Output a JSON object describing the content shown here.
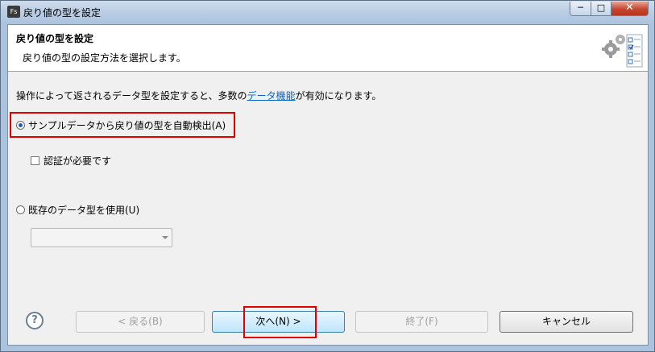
{
  "window": {
    "title": "戻り値の型を設定",
    "app_icon_text": "Fs",
    "controls": {
      "minimize": "─",
      "maximize": "□",
      "close": "✕"
    }
  },
  "banner": {
    "title": "戻り値の型を設定",
    "description": "戻り値の型の設定方法を選択します。",
    "icon": "gears-checklist-icon"
  },
  "info": {
    "prefix": "操作によって返されるデータ型を設定すると、多数の",
    "link": "データ機能",
    "suffix": "が有効になります。"
  },
  "options": {
    "auto_detect": {
      "label": "サンプルデータから戻り値の型を自動検出(A)",
      "selected": true
    },
    "auth_required": {
      "label": "認証が必要です",
      "checked": false
    },
    "existing_type": {
      "label": "既存のデータ型を使用(U)",
      "selected": false
    },
    "existing_type_combo": {
      "value": ""
    }
  },
  "buttons": {
    "help": "?",
    "back": "< 戻る(B)",
    "next": "次へ(N) >",
    "finish": "終了(F)",
    "cancel": "キャンセル"
  },
  "colors": {
    "highlight": "#e00000",
    "link": "#0066cc"
  }
}
